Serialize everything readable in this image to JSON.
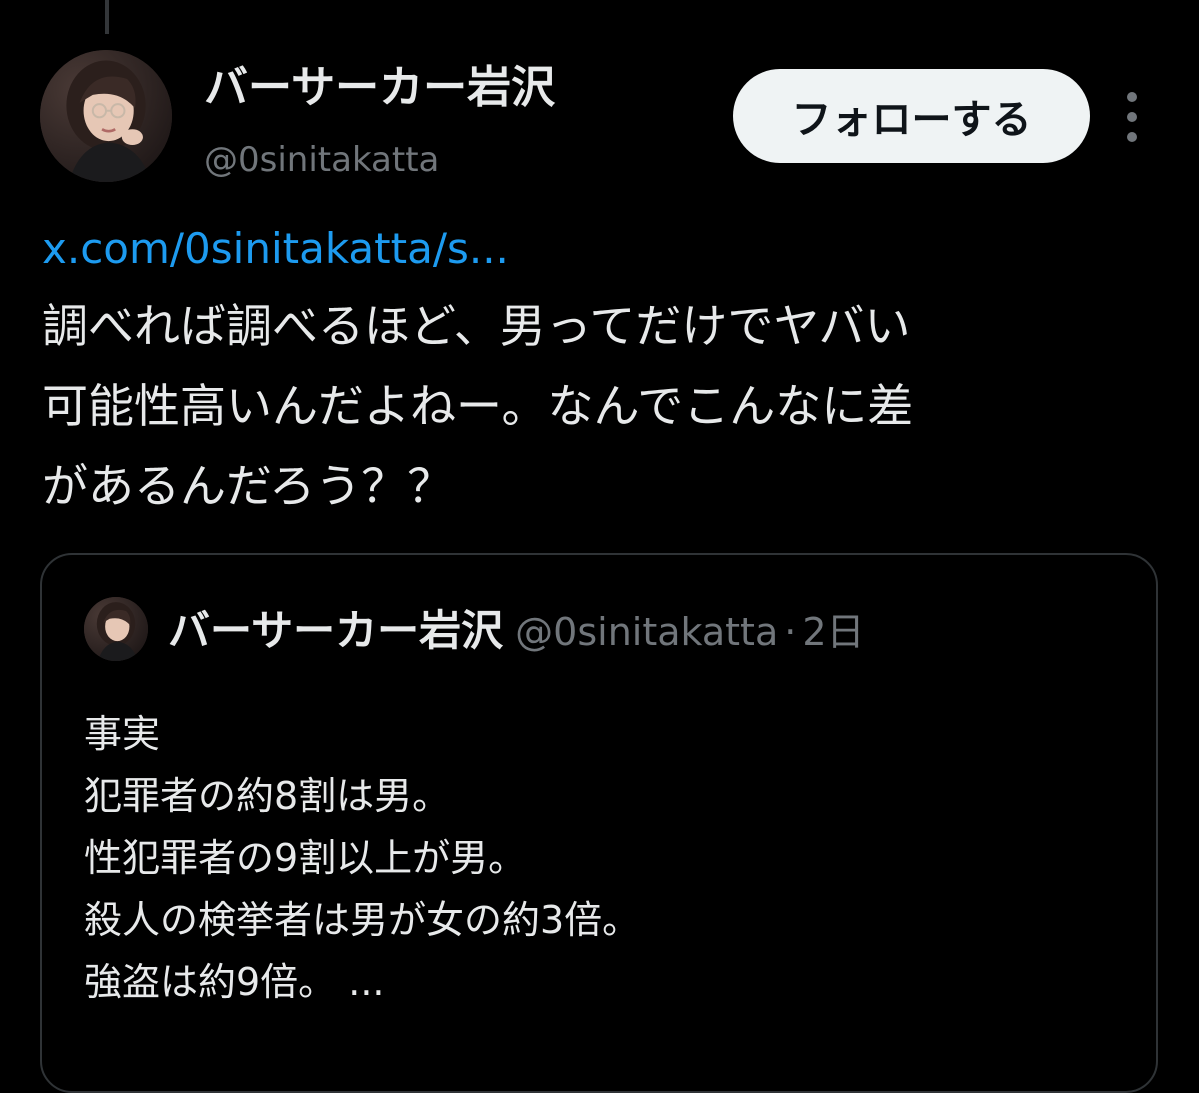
{
  "post": {
    "author": {
      "display_name": "バーサーカー岩沢",
      "handle": "@0sinitakatta"
    },
    "follow_label": "フォローする",
    "link_text": "x.com/0sinitakatta/s...",
    "text_lines": [
      "調べれば調べるほど、男ってだけでヤバい",
      "可能性高いんだよねー。なんでこんなに差",
      "があるんだろう？？"
    ]
  },
  "quoted_post": {
    "author": {
      "display_name": "バーサーカー岩沢",
      "handle": "@0sinitakatta"
    },
    "separator": "·",
    "time": "2日",
    "text_lines": [
      "事実",
      "犯罪者の約8割は男。",
      "性犯罪者の9割以上が男。",
      "殺人の検挙者は男が女の約3倍。",
      "強盗は約9倍。 ..."
    ]
  },
  "icons": {
    "avatar": "user-avatar-photo",
    "more": "more-vertical-icon"
  },
  "colors": {
    "background": "#000000",
    "text_primary": "#e7e9ea",
    "text_secondary": "#71767b",
    "link": "#1d9bf0",
    "follow_bg": "#eff3f4",
    "border": "#2f3336"
  }
}
